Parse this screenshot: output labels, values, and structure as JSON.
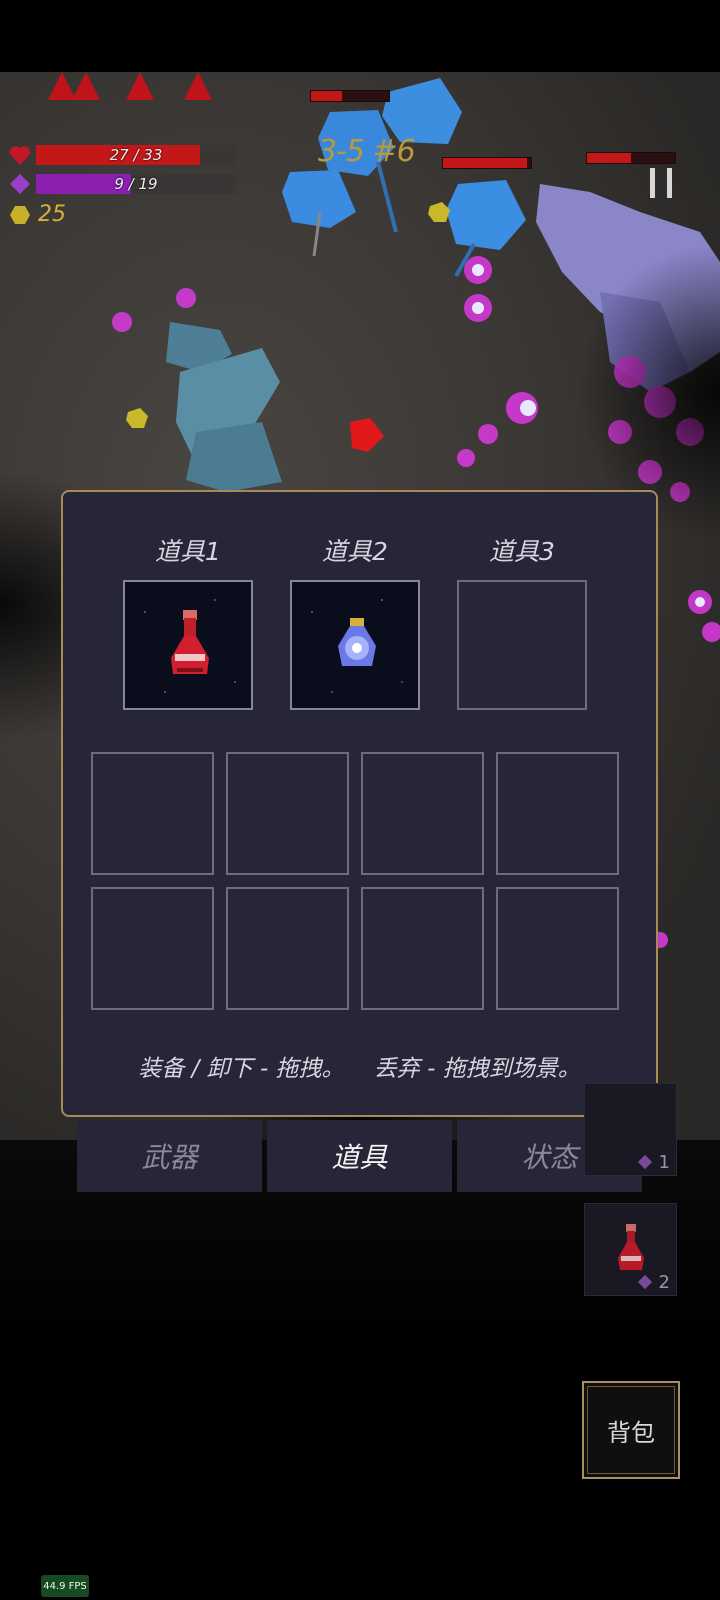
{
  "hud": {
    "hp_text": "27 / 33",
    "hp_fraction": 0.818,
    "mp_text": "9 / 19",
    "mp_fraction": 0.474,
    "gold": "25",
    "heart_icon": "heart-icon",
    "mana_icon": "purple-diamond-icon",
    "gold_icon": "gold-hexagon-icon",
    "colors": {
      "hp": "#c41818",
      "mp": "#8a1fb0",
      "gold": "#d8b03a"
    }
  },
  "stage": {
    "label": "3-5 #6"
  },
  "enemy_hp_fractions": [
    0.4,
    0.95,
    0.5
  ],
  "inventory": {
    "quick_slots": [
      {
        "label": "道具1",
        "item": "red-potion"
      },
      {
        "label": "道具2",
        "item": "blue-potion"
      },
      {
        "label": "道具3",
        "item": ""
      }
    ],
    "bag_slot_count": 8,
    "hint": "装备 / 卸下 - 拖拽。    丢弃 - 拖拽到场景。"
  },
  "tabs": [
    {
      "label": "武器",
      "active": false
    },
    {
      "label": "道具",
      "active": true
    },
    {
      "label": "状态",
      "active": false
    }
  ],
  "quick_bar": [
    {
      "number": "1"
    },
    {
      "number": "2",
      "item": "red-potion"
    }
  ],
  "backpack_button": {
    "label": "背包"
  },
  "fps": "44.9 FPS"
}
